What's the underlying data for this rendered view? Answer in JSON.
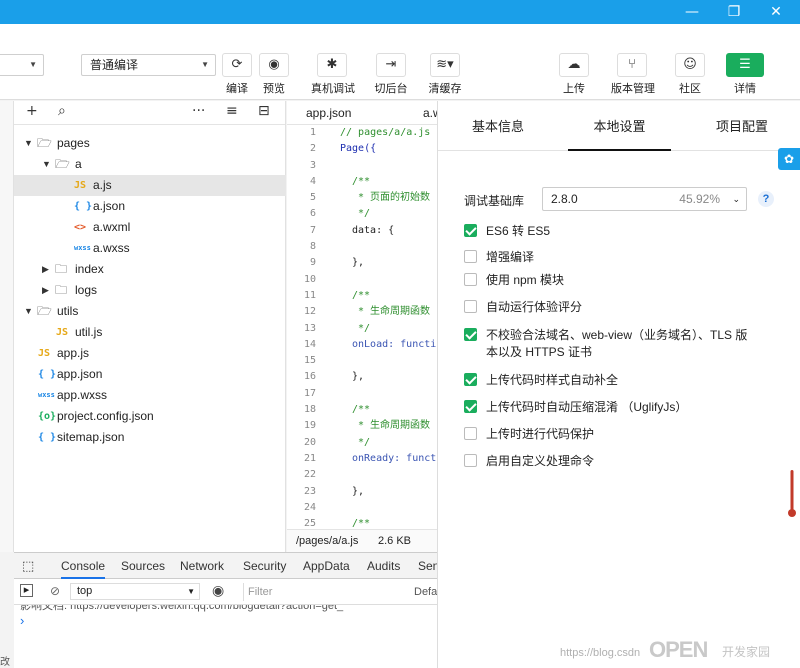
{
  "window": {
    "minimize": "—",
    "maximize": "❐",
    "close": "✕"
  },
  "toolbar": {
    "mode_select": "普通编译",
    "buttons": [
      {
        "label": "编译",
        "icon": "refresh-icon"
      },
      {
        "label": "预览",
        "icon": "eye-icon"
      },
      {
        "label": "真机调试",
        "icon": "bug-icon"
      },
      {
        "label": "切后台",
        "icon": "switch-background-icon"
      },
      {
        "label": "清缓存",
        "icon": "layers-icon"
      },
      {
        "label": "上传",
        "icon": "cloud-upload-icon"
      },
      {
        "label": "版本管理",
        "icon": "branch-icon"
      },
      {
        "label": "社区",
        "icon": "chat-icon"
      },
      {
        "label": "详情",
        "icon": "menu-icon"
      }
    ]
  },
  "tree": {
    "nodes": [
      {
        "name": "pages",
        "type": "folder",
        "depth": 0,
        "open": true
      },
      {
        "name": "a",
        "type": "folder",
        "depth": 1,
        "open": true
      },
      {
        "name": "a.js",
        "type": "js",
        "depth": 2,
        "selected": true
      },
      {
        "name": "a.json",
        "type": "json",
        "depth": 2
      },
      {
        "name": "a.wxml",
        "type": "wxml",
        "depth": 2
      },
      {
        "name": "a.wxss",
        "type": "wxss",
        "depth": 2
      },
      {
        "name": "index",
        "type": "folder",
        "depth": 1,
        "open": false
      },
      {
        "name": "logs",
        "type": "folder",
        "depth": 1,
        "open": false
      },
      {
        "name": "utils",
        "type": "folder",
        "depth": 0,
        "open": true
      },
      {
        "name": "util.js",
        "type": "js",
        "depth": 1
      },
      {
        "name": "app.js",
        "type": "js",
        "depth": 0
      },
      {
        "name": "app.json",
        "type": "json",
        "depth": 0
      },
      {
        "name": "app.wxss",
        "type": "wxss",
        "depth": 0
      },
      {
        "name": "project.config.json",
        "type": "config",
        "depth": 0
      },
      {
        "name": "sitemap.json",
        "type": "json",
        "depth": 0
      }
    ]
  },
  "editor": {
    "tabs": [
      "app.json",
      "a.w"
    ],
    "status_path": "/pages/a/a.js",
    "status_size": "2.6 KB",
    "lines": [
      {
        "n": "1",
        "t": "// pages/a/a.js",
        "c": "comment",
        "indent": 0
      },
      {
        "n": "2",
        "t": "Page({",
        "c": "kw",
        "indent": 0
      },
      {
        "n": "3",
        "t": "",
        "c": "",
        "indent": 0
      },
      {
        "n": "4",
        "t": "/**",
        "c": "comment",
        "indent": 1
      },
      {
        "n": "5",
        "t": " * 页面的初始数",
        "c": "comment",
        "indent": 1
      },
      {
        "n": "6",
        "t": " */",
        "c": "comment",
        "indent": 1
      },
      {
        "n": "7",
        "t": "data: {",
        "c": "",
        "indent": 1
      },
      {
        "n": "8",
        "t": "",
        "c": "",
        "indent": 0
      },
      {
        "n": "9",
        "t": "},",
        "c": "",
        "indent": 1
      },
      {
        "n": "10",
        "t": "",
        "c": "",
        "indent": 0
      },
      {
        "n": "11",
        "t": "/**",
        "c": "comment",
        "indent": 1
      },
      {
        "n": "12",
        "t": " * 生命周期函数",
        "c": "comment",
        "indent": 1
      },
      {
        "n": "13",
        "t": " */",
        "c": "comment",
        "indent": 1
      },
      {
        "n": "14",
        "t": "onLoad: functi",
        "c": "fn",
        "indent": 1
      },
      {
        "n": "15",
        "t": "",
        "c": "",
        "indent": 0
      },
      {
        "n": "16",
        "t": "},",
        "c": "",
        "indent": 1
      },
      {
        "n": "17",
        "t": "",
        "c": "",
        "indent": 0
      },
      {
        "n": "18",
        "t": "/**",
        "c": "comment",
        "indent": 1
      },
      {
        "n": "19",
        "t": " * 生命周期函数",
        "c": "comment",
        "indent": 1
      },
      {
        "n": "20",
        "t": " */",
        "c": "comment",
        "indent": 1
      },
      {
        "n": "21",
        "t": "onReady: funct",
        "c": "fn",
        "indent": 1
      },
      {
        "n": "22",
        "t": "",
        "c": "",
        "indent": 0
      },
      {
        "n": "23",
        "t": "},",
        "c": "",
        "indent": 1
      },
      {
        "n": "24",
        "t": "",
        "c": "",
        "indent": 0
      },
      {
        "n": "25",
        "t": "/**",
        "c": "comment",
        "indent": 1
      }
    ]
  },
  "devtools": {
    "tabs": [
      "Console",
      "Sources",
      "Network",
      "Security",
      "AppData",
      "Audits",
      "Sen"
    ],
    "context": "top",
    "filter_placeholder": "Filter",
    "level": "Defa",
    "log_line": "影响文档: https://developers.weixin.qq.com/blogdetail?action=get_",
    "prompt": "›",
    "bottom_char": "改"
  },
  "settings": {
    "tabs": [
      "基本信息",
      "本地设置",
      "项目配置"
    ],
    "active_tab": 1,
    "lib_label": "调试基础库",
    "lib_version": "2.8.0",
    "lib_percent": "45.92%",
    "help": "?",
    "options": [
      {
        "label": "ES6 转 ES5",
        "checked": true
      },
      {
        "label": "增强编译",
        "checked": false
      },
      {
        "label": "使用 npm 模块",
        "checked": false
      },
      {
        "label": "自动运行体验评分",
        "checked": false
      },
      {
        "label": "不校验合法域名、web-view（业务域名）、TLS 版",
        "label2": "本以及 HTTPS 证书",
        "checked": true
      },
      {
        "label": "上传代码时样式自动补全",
        "checked": true
      },
      {
        "label": "上传代码时自动压缩混淆 （UglifyJs）",
        "checked": true
      },
      {
        "label": "上传时进行代码保护",
        "checked": false
      },
      {
        "label": "启用自定义处理命令",
        "checked": false
      }
    ]
  },
  "watermark": {
    "url": "https://blog.csdn",
    "brand": "OPEN",
    "brand_cn": "开发家园"
  },
  "colors": {
    "titlebar": "#1a9fe9",
    "accent_green": "#1aad5d",
    "js_icon": "#e6a817",
    "json_icon": "#1e88e5",
    "wxml_icon": "#e45b2b",
    "config_icon": "#1aad5d"
  }
}
